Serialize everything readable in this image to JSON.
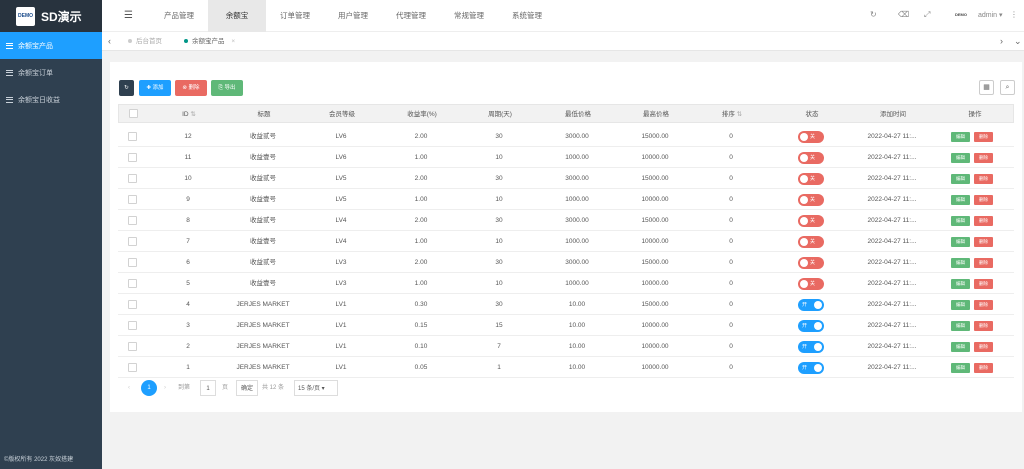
{
  "sidebar": {
    "logo_text": "DEMO",
    "title": "SD演示",
    "items": [
      {
        "label": "余额宝产品",
        "active": true
      },
      {
        "label": "余额宝订单",
        "active": false
      },
      {
        "label": "余额宝日收益",
        "active": false
      }
    ],
    "copyright": "©版权所有 2022 灰奴搭建"
  },
  "topnav": {
    "tabs": [
      {
        "label": "产品管理"
      },
      {
        "label": "余额宝"
      },
      {
        "label": "订单管理"
      },
      {
        "label": "用户管理"
      },
      {
        "label": "代理管理"
      },
      {
        "label": "常规管理"
      },
      {
        "label": "系统管理"
      }
    ],
    "active_index": 1,
    "admin_avatar": "DEMO",
    "admin_name": "admin"
  },
  "pagetabs": {
    "items": [
      {
        "label": "后台首页"
      },
      {
        "label": "余额宝产品"
      }
    ]
  },
  "toolbar": {
    "refresh": "",
    "add": "✚ 添加",
    "delete": "⊗ 删除",
    "export": "⎘ 导出"
  },
  "table": {
    "headers": [
      "ID",
      "标题",
      "会员等级",
      "收益率(%)",
      "周期(天)",
      "最低价格",
      "最高价格",
      "排序",
      "状态",
      "添加时间",
      "操作"
    ],
    "status_on": "开",
    "status_off": "关",
    "edit_label": "编辑",
    "delete_label": "删除",
    "rows": [
      {
        "id": "12",
        "title": "收益贰号",
        "level": "LV6",
        "rate": "2.00",
        "cycle": "30",
        "min": "3000.00",
        "max": "15000.00",
        "sort": "0",
        "on": false,
        "time": "2022-04-27 11:..."
      },
      {
        "id": "11",
        "title": "收益壹号",
        "level": "LV6",
        "rate": "1.00",
        "cycle": "10",
        "min": "1000.00",
        "max": "10000.00",
        "sort": "0",
        "on": false,
        "time": "2022-04-27 11:..."
      },
      {
        "id": "10",
        "title": "收益贰号",
        "level": "LV5",
        "rate": "2.00",
        "cycle": "30",
        "min": "3000.00",
        "max": "15000.00",
        "sort": "0",
        "on": false,
        "time": "2022-04-27 11:..."
      },
      {
        "id": "9",
        "title": "收益壹号",
        "level": "LV5",
        "rate": "1.00",
        "cycle": "10",
        "min": "1000.00",
        "max": "10000.00",
        "sort": "0",
        "on": false,
        "time": "2022-04-27 11:..."
      },
      {
        "id": "8",
        "title": "收益贰号",
        "level": "LV4",
        "rate": "2.00",
        "cycle": "30",
        "min": "3000.00",
        "max": "15000.00",
        "sort": "0",
        "on": false,
        "time": "2022-04-27 11:..."
      },
      {
        "id": "7",
        "title": "收益壹号",
        "level": "LV4",
        "rate": "1.00",
        "cycle": "10",
        "min": "1000.00",
        "max": "10000.00",
        "sort": "0",
        "on": false,
        "time": "2022-04-27 11:..."
      },
      {
        "id": "6",
        "title": "收益贰号",
        "level": "LV3",
        "rate": "2.00",
        "cycle": "30",
        "min": "3000.00",
        "max": "15000.00",
        "sort": "0",
        "on": false,
        "time": "2022-04-27 11:..."
      },
      {
        "id": "5",
        "title": "收益壹号",
        "level": "LV3",
        "rate": "1.00",
        "cycle": "10",
        "min": "1000.00",
        "max": "10000.00",
        "sort": "0",
        "on": false,
        "time": "2022-04-27 11:..."
      },
      {
        "id": "4",
        "title": "JERJES MARKET",
        "level": "LV1",
        "rate": "0.30",
        "cycle": "30",
        "min": "10.00",
        "max": "15000.00",
        "sort": "0",
        "on": true,
        "time": "2022-04-27 11:..."
      },
      {
        "id": "3",
        "title": "JERJES MARKET",
        "level": "LV1",
        "rate": "0.15",
        "cycle": "15",
        "min": "10.00",
        "max": "10000.00",
        "sort": "0",
        "on": true,
        "time": "2022-04-27 11:..."
      },
      {
        "id": "2",
        "title": "JERJES MARKET",
        "level": "LV1",
        "rate": "0.10",
        "cycle": "7",
        "min": "10.00",
        "max": "10000.00",
        "sort": "0",
        "on": true,
        "time": "2022-04-27 11:..."
      },
      {
        "id": "1",
        "title": "JERJES MARKET",
        "level": "LV1",
        "rate": "0.05",
        "cycle": "1",
        "min": "10.00",
        "max": "10000.00",
        "sort": "0",
        "on": true,
        "time": "2022-04-27 11:..."
      }
    ]
  },
  "pagination": {
    "current": "1",
    "goto_label": "到第",
    "page_input": "1",
    "page_unit": "页",
    "confirm": "确定",
    "total": "共 12 条",
    "per_page": "15 条/页"
  },
  "colors": {
    "sidebar_bg": "#2f4050",
    "accent": "#1e9fff",
    "edit": "#5fb878",
    "danger": "#e96a62",
    "export": "#5fb878",
    "refresh": "#2f4050"
  }
}
